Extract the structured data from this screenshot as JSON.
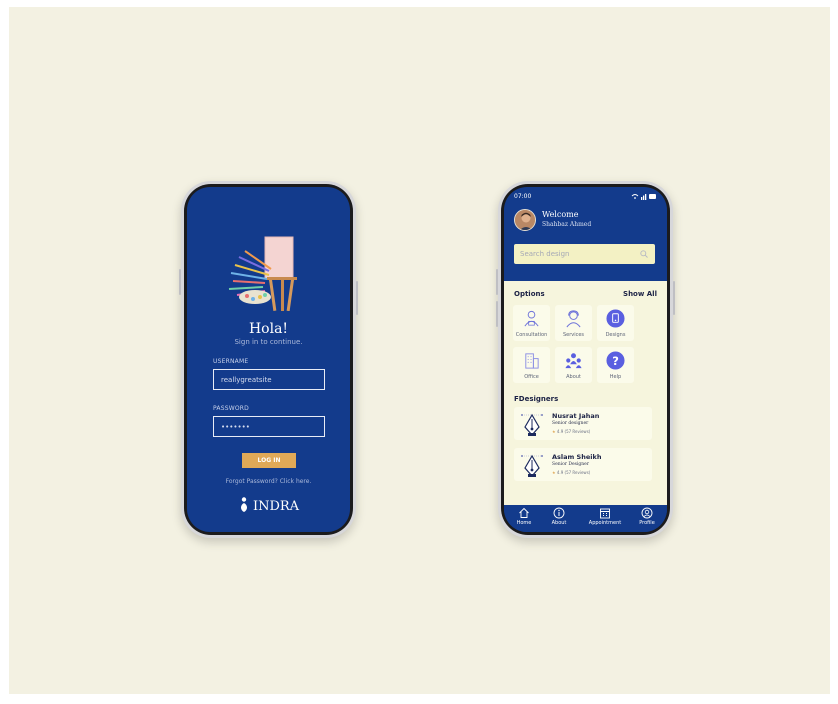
{
  "colors": {
    "background": "#f3f1e2",
    "primary_blue": "#133b8c",
    "login_button": "#e0a957",
    "search_bg": "#f3f1c4",
    "content_bg": "#f6f5dd",
    "icon_purple": "#5a5fe0"
  },
  "login": {
    "greeting": "Hola!",
    "subtitle": "Sign in to continue.",
    "username_label": "USERNAME",
    "username_value": "reallygreatsite",
    "password_label": "PASSWORD",
    "password_value": "•••••••",
    "login_button": "LOG IN",
    "forgot_text": "Forgot Password? Click here.",
    "brand": "INDRA"
  },
  "app": {
    "status": {
      "time": "07:00",
      "icons": "wifi signal battery"
    },
    "header": {
      "welcome": "Welcome",
      "user_name": "Shahbaz Ahmed"
    },
    "search": {
      "placeholder": "Search design",
      "icon": "search-icon"
    },
    "options": {
      "title": "Options",
      "show_all": "Show All",
      "items": [
        {
          "label": "Consultation",
          "icon": "consultation-icon"
        },
        {
          "label": "Services",
          "icon": "services-icon"
        },
        {
          "label": "Designs",
          "icon": "designs-icon"
        },
        {
          "label": "Office",
          "icon": "office-icon"
        },
        {
          "label": "About",
          "icon": "people-icon"
        },
        {
          "label": "Help",
          "icon": "help-icon"
        }
      ]
    },
    "designers": {
      "title": "FDesigners",
      "items": [
        {
          "name": "Nusrat Jahan",
          "role": "Senior designer",
          "rating": "4.9 (57 Reviews)"
        },
        {
          "name": "Aslam Sheikh",
          "role": "Senior Designer",
          "rating": "4.9 (57 Reviews)"
        }
      ]
    },
    "nav": [
      {
        "label": "Home",
        "icon": "home-icon"
      },
      {
        "label": "About",
        "icon": "info-icon"
      },
      {
        "label": "Appointment",
        "icon": "calendar-icon"
      },
      {
        "label": "Profile",
        "icon": "profile-icon"
      }
    ]
  }
}
